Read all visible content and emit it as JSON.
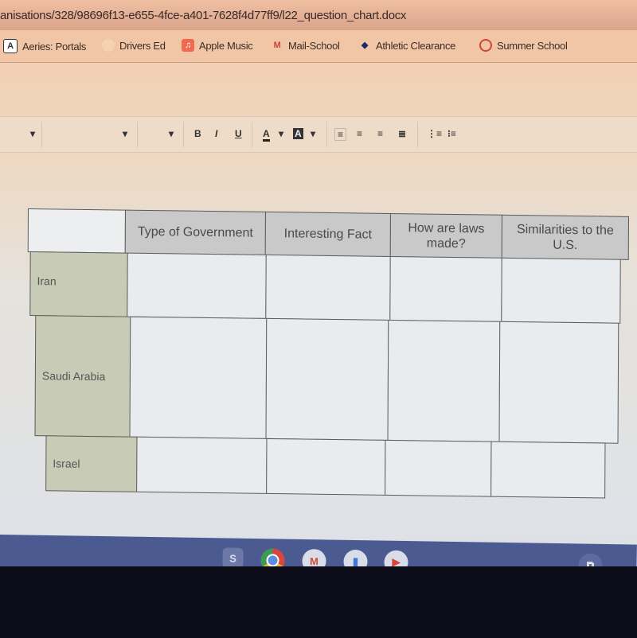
{
  "browser": {
    "url": "anisations/328/98696f13-e655-4fce-a401-7628f4d77ff9/l22_question_chart.docx",
    "bookmarks": [
      {
        "label": "Aeries: Portals",
        "icon": "aeries-icon"
      },
      {
        "label": "Drivers Ed",
        "icon": "globe-icon"
      },
      {
        "label": "Apple Music",
        "icon": "music-icon"
      },
      {
        "label": "Mail-School",
        "icon": "gmail-icon"
      },
      {
        "label": "Athletic Clearance",
        "icon": "bolt-icon"
      },
      {
        "label": "Summer School",
        "icon": "circle-icon"
      }
    ]
  },
  "toolbar": {
    "bold": "B",
    "italic": "I",
    "underline": "U",
    "font_color": "A",
    "highlight": "A"
  },
  "table": {
    "headers": [
      "Type of Government",
      "Interesting Fact",
      "How are laws made?",
      "Similarities to the U.S."
    ],
    "rows": [
      {
        "label": "Iran"
      },
      {
        "label": "Saudi Arabia"
      },
      {
        "label": "Israel"
      }
    ],
    "colors": {
      "header": "#c9c9c9",
      "row_header": "#c8ccb6"
    }
  },
  "taskbar": {
    "apps": [
      {
        "label": "S",
        "icon": "app-s-icon"
      },
      {
        "icon": "chrome-icon"
      },
      {
        "icon": "gmail-icon"
      },
      {
        "icon": "docs-icon"
      },
      {
        "icon": "youtube-icon"
      }
    ]
  }
}
